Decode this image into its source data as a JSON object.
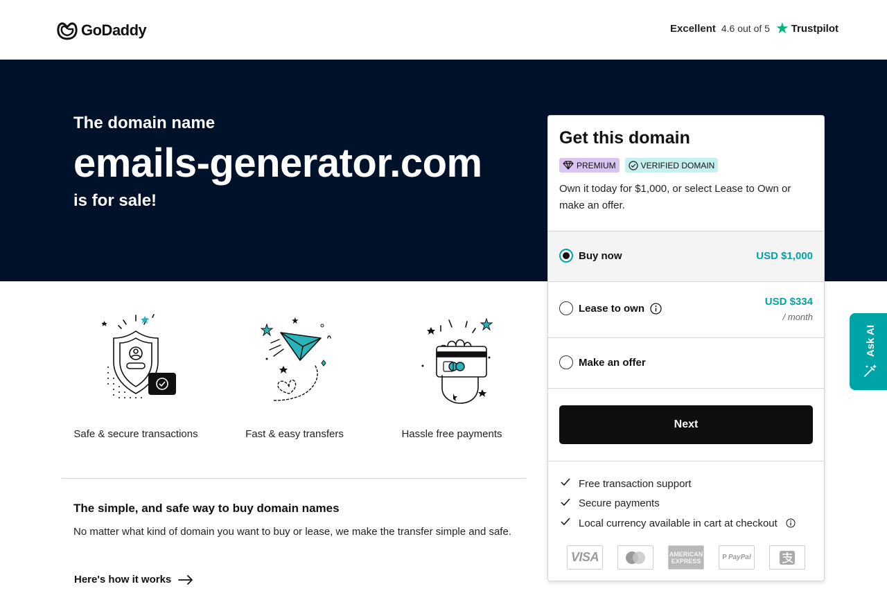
{
  "header": {
    "logo_text": "GoDaddy",
    "trust_rating": "Excellent",
    "trust_score": "4.6 out of 5",
    "trust_brand": "Trustpilot"
  },
  "hero": {
    "pre": "The domain name",
    "domain": "emails-generator.com",
    "post": "is for sale!"
  },
  "features": [
    {
      "label": "Safe & secure transactions",
      "icon": "shield-icon"
    },
    {
      "label": "Fast & easy transfers",
      "icon": "paper-plane-icon"
    },
    {
      "label": "Hassle free payments",
      "icon": "hand-card-icon"
    }
  ],
  "info": {
    "title": "The simple, and safe way to buy domain names",
    "body": "No matter what kind of domain you want to buy or lease, we make the transfer simple and safe.",
    "link": "Here's how it works"
  },
  "card": {
    "title": "Get this domain",
    "badge_premium": "PREMIUM",
    "badge_verified": "VERIFIED DOMAIN",
    "description": "Own it today for $1,000, or select Lease to Own or make an offer.",
    "options": {
      "buy": {
        "label": "Buy now",
        "price": "USD $1,000",
        "selected": true
      },
      "lease": {
        "label": "Lease to own",
        "price": "USD $334",
        "sub": "/ month",
        "selected": false
      },
      "offer": {
        "label": "Make an offer",
        "selected": false
      }
    },
    "next_label": "Next",
    "benefits": [
      "Free transaction support",
      "Secure payments",
      "Local currency available in cart at checkout"
    ],
    "payments": {
      "visa": "VISA",
      "amex": "AMERICAN EXPRESS",
      "paypal": "PayPal"
    }
  },
  "askai": {
    "label": "Ask AI"
  },
  "colors": {
    "hero_bg": "#00112a",
    "accent": "#00a4a6",
    "button": "#0f0f0f",
    "trustpilot_green": "#00b67a"
  }
}
